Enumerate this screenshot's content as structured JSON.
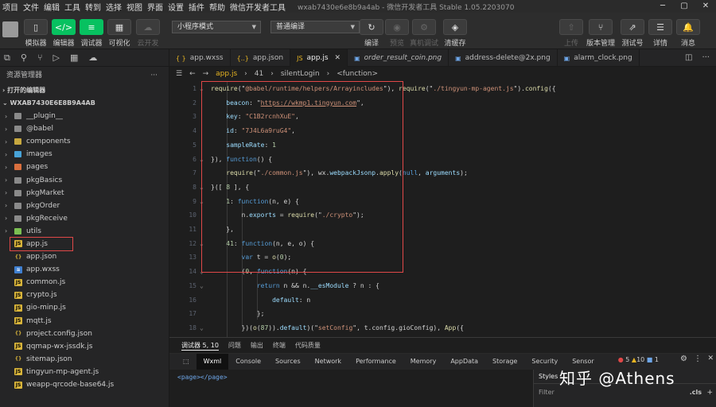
{
  "menu": [
    "项目",
    "文件",
    "编辑",
    "工具",
    "转到",
    "选择",
    "视图",
    "界面",
    "设置",
    "插件",
    "帮助",
    "微信开发者工具"
  ],
  "window_title": "wxab7430e6e8b9a4ab - 微信开发者工具 Stable 1.05.2203070",
  "toolbar": {
    "simulator": "模拟器",
    "editor": "编辑器",
    "debugger": "调试器",
    "visual": "可视化",
    "cloud": "云开发",
    "mode_select": "小程序模式",
    "compile_select": "普通编译",
    "compile": "编译",
    "preview": "预览",
    "remote_debug": "真机调试",
    "clear_cache": "清缓存",
    "upload": "上传",
    "version": "版本管理",
    "test": "测试号",
    "details": "详情",
    "messages": "消息"
  },
  "sidebar": {
    "title": "资源管理器",
    "open_editors": "打开的编辑器",
    "project": "WXAB7430E6E8B9A4AB",
    "tree": [
      {
        "label": "__plugin__",
        "type": "folder",
        "color": "#8a8a8a"
      },
      {
        "label": "@babel",
        "type": "folder",
        "color": "#8a8a8a"
      },
      {
        "label": "components",
        "type": "folder",
        "color": "#c7a83f"
      },
      {
        "label": "images",
        "type": "folder",
        "color": "#48a3d8"
      },
      {
        "label": "pages",
        "type": "folder",
        "color": "#d96f3e"
      },
      {
        "label": "pkgBasics",
        "type": "folder",
        "color": "#8a8a8a"
      },
      {
        "label": "pkgMarket",
        "type": "folder",
        "color": "#8a8a8a"
      },
      {
        "label": "pkgOrder",
        "type": "folder",
        "color": "#8a8a8a"
      },
      {
        "label": "pkgReceive",
        "type": "folder",
        "color": "#8a8a8a"
      },
      {
        "label": "utils",
        "type": "folder",
        "color": "#7bbf52"
      },
      {
        "label": "app.js",
        "type": "js",
        "selected": true
      },
      {
        "label": "app.json",
        "type": "json"
      },
      {
        "label": "app.wxss",
        "type": "wxss"
      },
      {
        "label": "common.js",
        "type": "js"
      },
      {
        "label": "crypto.js",
        "type": "js"
      },
      {
        "label": "gio-minp.js",
        "type": "js"
      },
      {
        "label": "mqtt.js",
        "type": "js"
      },
      {
        "label": "project.config.json",
        "type": "json"
      },
      {
        "label": "qqmap-wx-jssdk.js",
        "type": "js"
      },
      {
        "label": "sitemap.json",
        "type": "json"
      },
      {
        "label": "tingyun-mp-agent.js",
        "type": "js"
      },
      {
        "label": "weapp-qrcode-base64.js",
        "type": "js"
      }
    ]
  },
  "tabs": [
    {
      "label": "app.wxss",
      "icon": "{ }",
      "active": false,
      "italic": false
    },
    {
      "label": "app.json",
      "icon": "{..}",
      "active": false,
      "italic": false
    },
    {
      "label": "app.js",
      "icon": "JS",
      "active": true,
      "italic": false
    },
    {
      "label": "order_result_coin.png",
      "icon": "▣",
      "active": false,
      "italic": true
    },
    {
      "label": "address-delete@2x.png",
      "icon": "▣",
      "active": false,
      "italic": false
    },
    {
      "label": "alarm_clock.png",
      "icon": "▣",
      "active": false,
      "italic": false
    }
  ],
  "breadcrumb": [
    "app.js",
    "41",
    "silentLogin",
    "<function>"
  ],
  "bottom": {
    "tabs": [
      "调试器",
      "5, 10",
      "问题",
      "输出",
      "终端",
      "代码质量"
    ],
    "devtools": [
      "Wxml",
      "Console",
      "Sources",
      "Network",
      "Performance",
      "Memory",
      "AppData",
      "Storage",
      "Security",
      "Sensor"
    ],
    "errors": "5",
    "warnings": "10",
    "info": "1",
    "console_line": "<page></page>",
    "styles": "Styles",
    "filter": "Filter",
    "cls": ".cls"
  },
  "watermark": "知乎 @Athens",
  "colors": {
    "accent": "#07c160",
    "highlight": "#e04848"
  }
}
